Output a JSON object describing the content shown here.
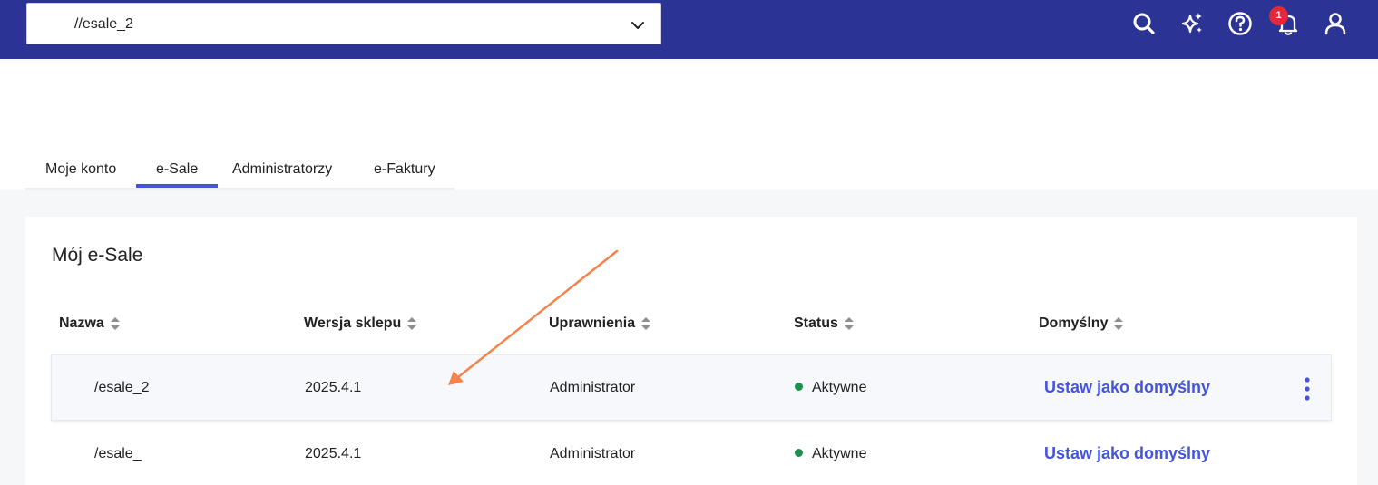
{
  "header": {
    "shop_select_value": "//esale_2",
    "icons": [
      "search-icon",
      "sparkle-icon",
      "help-icon",
      "bell-icon",
      "user-icon"
    ],
    "notification_count": "1"
  },
  "tabs": [
    {
      "label": "Moje konto"
    },
    {
      "label": "e-Sale"
    },
    {
      "label": "Administratorzy"
    },
    {
      "label": "e-Faktury"
    }
  ],
  "active_tab": "e-Sale",
  "card": {
    "title": "Mój e-Sale",
    "columns": [
      "Nazwa",
      "Wersja sklepu",
      "Uprawnienia",
      "Status",
      "Domyślny"
    ],
    "rows": [
      {
        "name": "/esale_2",
        "version": "2025.4.1",
        "role": "Administrator",
        "status": "Aktywne",
        "action": "Ustaw jako domyślny"
      },
      {
        "name": "/esale_",
        "version": "2025.4.1",
        "role": "Administrator",
        "status": "Aktywne",
        "action": "Ustaw jako domyślny"
      }
    ]
  },
  "colors": {
    "header_bg": "#2b3494",
    "accent": "#4455d9",
    "status_active": "#1e8f4e",
    "badge": "#e3283a",
    "annotation_arrow": "#f5844c"
  }
}
